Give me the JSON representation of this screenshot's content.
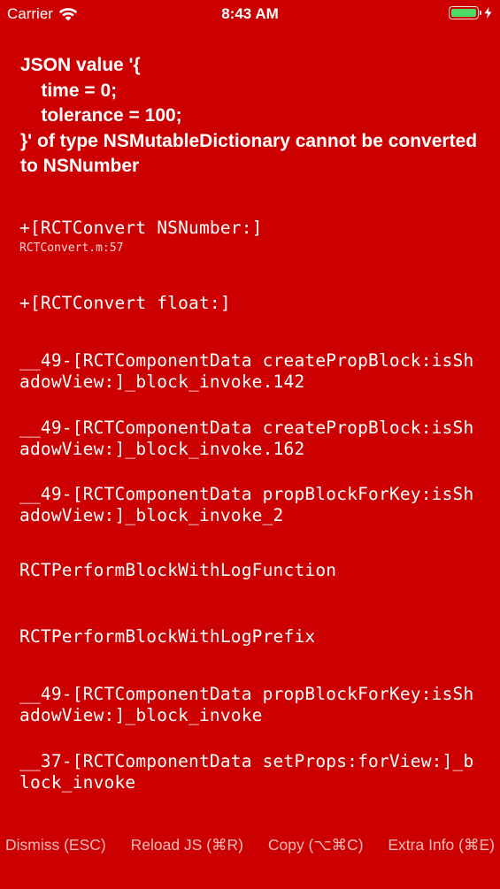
{
  "status_bar": {
    "carrier": "Carrier",
    "time": "8:43 AM",
    "battery_level_percent": 100,
    "battery_color": "#4cd964",
    "wifi_icon": "wifi-icon",
    "charging_icon": "bolt-icon"
  },
  "error": {
    "message": "JSON value '{\n    time = 0;\n    tolerance = 100;\n}' of type NSMutableDictionary cannot be converted to NSNumber"
  },
  "stack": [
    {
      "method": "+[RCTConvert NSNumber:]",
      "file": "RCTConvert.m:57"
    },
    {
      "method": "+[RCTConvert float:]",
      "file": ""
    },
    {
      "method": "__49-[RCTComponentData createPropBlock:isShadowView:]_block_invoke.142",
      "file": ""
    },
    {
      "method": "__49-[RCTComponentData createPropBlock:isShadowView:]_block_invoke.162",
      "file": ""
    },
    {
      "method": "__49-[RCTComponentData propBlockForKey:isShadowView:]_block_invoke_2",
      "file": ""
    },
    {
      "method": "RCTPerformBlockWithLogFunction",
      "file": ""
    },
    {
      "method": "RCTPerformBlockWithLogPrefix",
      "file": ""
    },
    {
      "method": "__49-[RCTComponentData propBlockForKey:isShadowView:]_block_invoke",
      "file": ""
    },
    {
      "method": "__37-[RCTComponentData setProps:forView:]_block_invoke",
      "file": ""
    }
  ],
  "buttons": {
    "dismiss": "Dismiss (ESC)",
    "reload": "Reload JS (⌘R)",
    "copy": "Copy (⌥⌘C)",
    "extra_info": "Extra Info (⌘E)"
  },
  "colors": {
    "background": "#cc0000",
    "text": "#ffffff"
  }
}
